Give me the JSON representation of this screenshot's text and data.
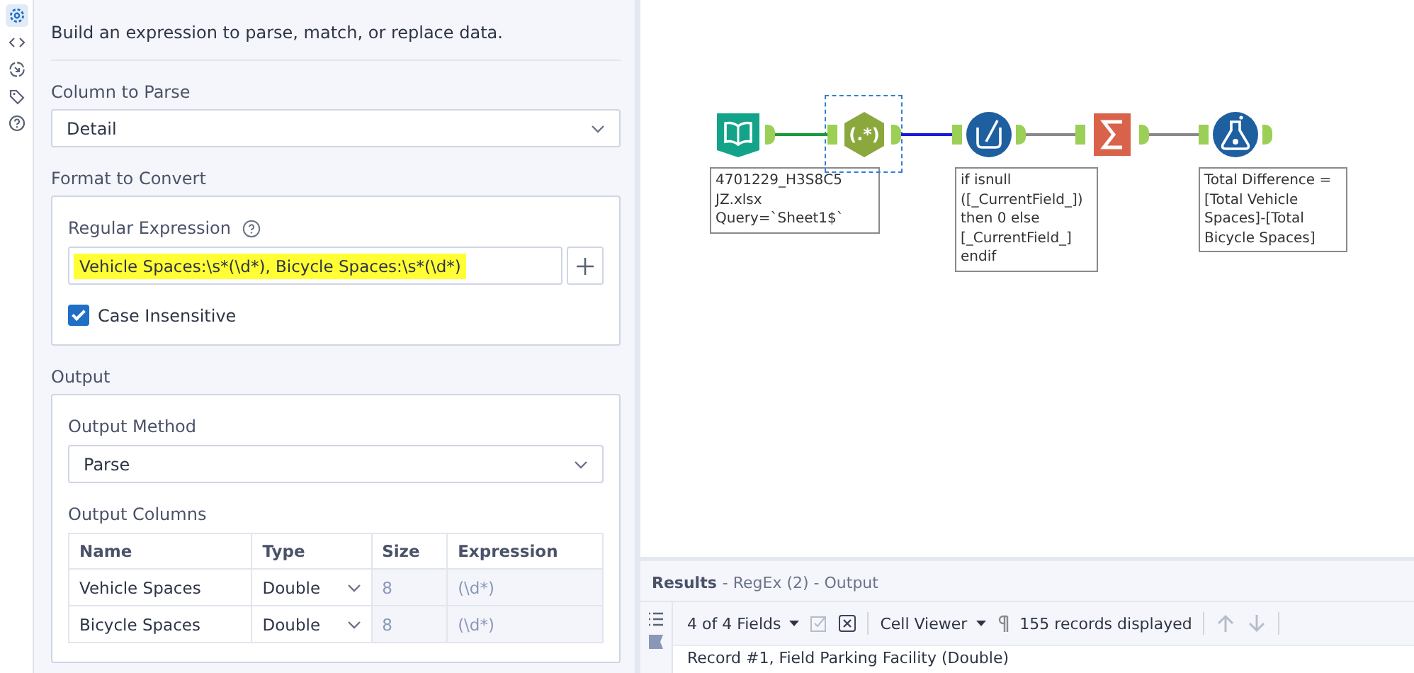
{
  "rail": [
    {
      "kind": "settings",
      "selected": true
    },
    {
      "kind": "code",
      "selected": false
    },
    {
      "kind": "target",
      "selected": false
    },
    {
      "kind": "tag",
      "selected": false
    },
    {
      "kind": "help",
      "selected": false
    }
  ],
  "description": "Build an expression to parse, match, or replace data.",
  "column_to_parse": {
    "label": "Column to Parse",
    "value": "Detail"
  },
  "format": {
    "heading": "Format to Convert",
    "regex_label": "Regular Expression",
    "regex_value": "Vehicle Spaces:\\s*(\\d*), Bicycle Spaces:\\s*(\\d*)",
    "highlighted": true,
    "case_insensitive": {
      "label": "Case Insensitive",
      "checked": true
    }
  },
  "output": {
    "heading": "Output",
    "method_label": "Output Method",
    "method_value": "Parse",
    "columns_label": "Output Columns",
    "columns": [
      "Name",
      "Type",
      "Size",
      "Expression"
    ],
    "rows": [
      {
        "name": "Vehicle Spaces",
        "type": "Double",
        "size": "8",
        "expression": "(\\d*)"
      },
      {
        "name": "Bicycle Spaces",
        "type": "Double",
        "size": "8",
        "expression": "(\\d*)"
      }
    ]
  },
  "canvas": {
    "nodes": [
      {
        "kind": "input",
        "selected": false,
        "annotation": [
          "4701229_H3S8C5",
          "JZ.xlsx",
          "Query=`Sheet1$`"
        ]
      },
      {
        "kind": "regex",
        "selected": true,
        "label": "(.*)"
      },
      {
        "kind": "formula",
        "selected": false,
        "annotation": [
          "if isnull",
          "([_CurrentField_])",
          "then 0 else",
          "[_CurrentField_]",
          "endif"
        ]
      },
      {
        "kind": "summarize",
        "selected": false
      },
      {
        "kind": "formula",
        "selected": false,
        "annotation": [
          "Total Difference =",
          "[Total Vehicle",
          "Spaces]-[Total",
          "Bicycle Spaces]"
        ]
      }
    ],
    "connections": [
      {
        "color": "#1a9a3a"
      },
      {
        "color": "#1a1adc"
      },
      {
        "color": "#8a8a8a"
      },
      {
        "color": "#8a8a8a"
      }
    ]
  },
  "results": {
    "title": "Results",
    "subtitle": "- RegEx (2) - Output",
    "fields": "4 of 4 Fields",
    "viewer": "Cell Viewer",
    "records": "155 records displayed",
    "record_line": "Record #1, Field Parking Facility (Double)"
  }
}
